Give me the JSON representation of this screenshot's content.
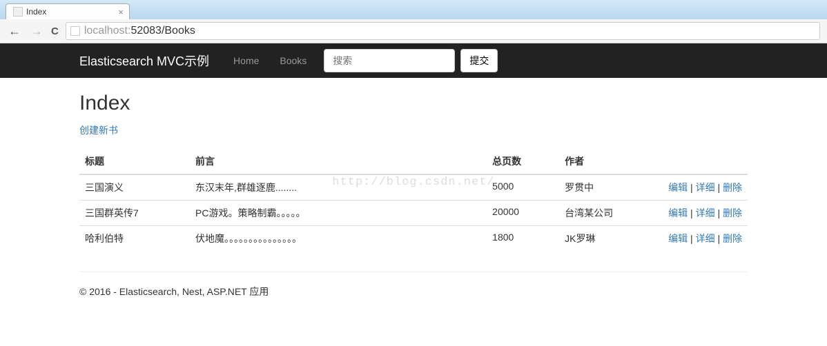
{
  "browser": {
    "tab_title": "Index",
    "url_host": "localhost:",
    "url_port": "52083",
    "url_path": "/Books"
  },
  "navbar": {
    "brand": "Elasticsearch MVC示例",
    "links": [
      "Home",
      "Books"
    ],
    "search_placeholder": "搜索",
    "submit_label": "提交"
  },
  "page": {
    "heading": "Index",
    "create_link": "创建新书"
  },
  "table": {
    "headers": {
      "title": "标题",
      "intro": "前言",
      "pages": "总页数",
      "author": "作者"
    },
    "rows": [
      {
        "title": "三国演义",
        "intro": "东汉末年,群雄逐鹿........",
        "pages": "5000",
        "author": "罗贯中"
      },
      {
        "title": "三国群英传7",
        "intro": "PC游戏。策略制霸。。。。。",
        "pages": "20000",
        "author": "台湾某公司"
      },
      {
        "title": "哈利伯特",
        "intro": "伏地魔。。。。。。。。。。。。。。。",
        "pages": "1800",
        "author": "JK罗琳"
      }
    ],
    "actions": {
      "edit": "编辑",
      "details": "详细",
      "delete": "删除"
    }
  },
  "watermark": "http://blog.csdn.net/",
  "footer": "© 2016 - Elasticsearch, Nest, ASP.NET 应用"
}
